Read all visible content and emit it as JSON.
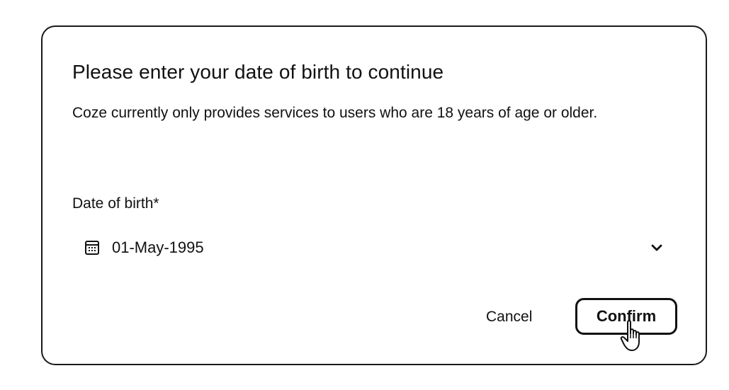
{
  "dialog": {
    "title": "Please enter your date of birth to continue",
    "description": "Coze currently only provides services to users who are 18 years of age or older.",
    "field_label": "Date of birth*",
    "date_value": "01-May-1995",
    "cancel_label": "Cancel",
    "confirm_label": "Confirm"
  },
  "icons": {
    "calendar": "calendar-icon",
    "chevron": "chevron-down-icon",
    "cursor": "hand-pointer-cursor-icon"
  },
  "colors": {
    "text": "#111111",
    "border": "#1a1a1a",
    "background": "#ffffff"
  }
}
